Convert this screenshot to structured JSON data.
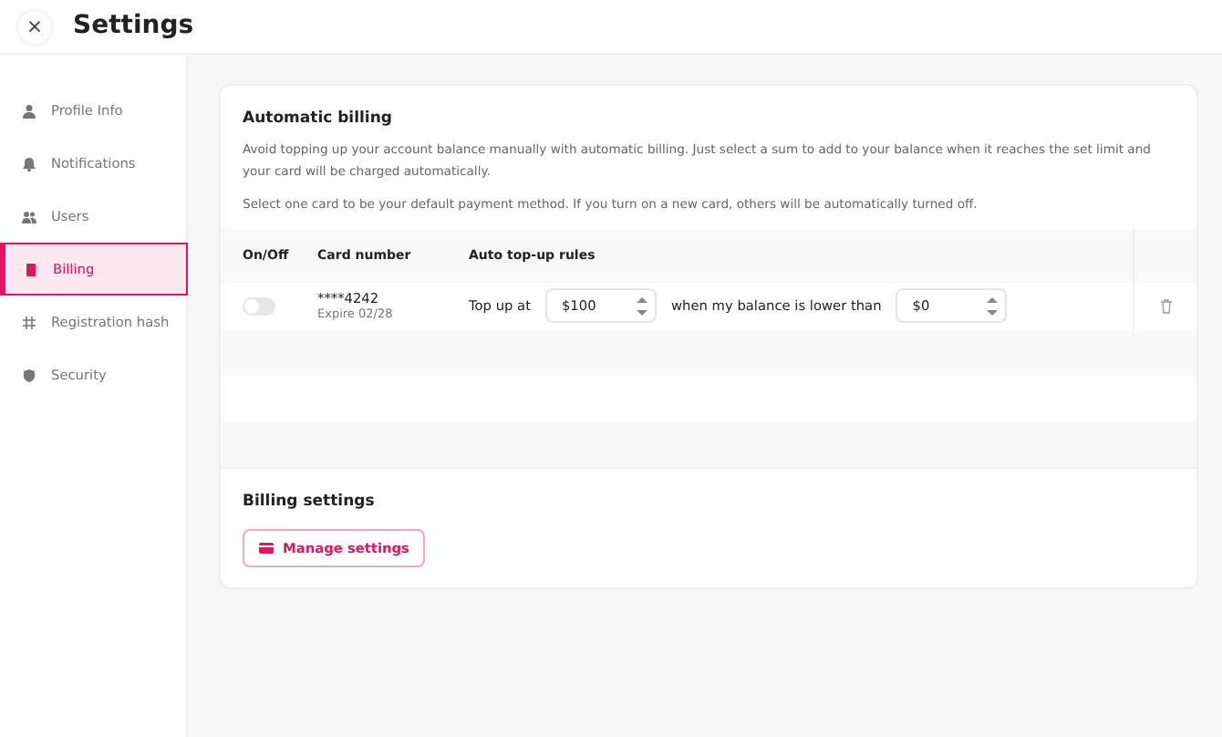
{
  "window": {
    "title": "Settings",
    "close": "×"
  },
  "sidebar": {
    "items": [
      {
        "label": "Profile Info",
        "kind": "person",
        "selected": false
      },
      {
        "label": "Notifications",
        "kind": "bell",
        "selected": false
      },
      {
        "label": "Users",
        "kind": "users",
        "selected": false
      },
      {
        "label": "Billing",
        "kind": "doc",
        "selected": true
      },
      {
        "label": "Registration hash",
        "kind": "hash",
        "selected": false
      },
      {
        "label": "Security",
        "kind": "shield",
        "selected": false
      }
    ]
  },
  "auto_billing": {
    "title": "Automatic billing",
    "description": "Avoid topping up your account balance manually with automatic billing. Just select a sum to add to your balance when it reaches the set limit and your card will be charged automatically.",
    "note": "Select one card to be your default payment method. If you turn on a new card, others will be automatically turned off.",
    "table": {
      "columns": [
        "On/Off",
        "Card number",
        "Auto top-up rules"
      ],
      "rows": [
        {
          "on": false,
          "card": "****4242",
          "expire": "Expire 02/28",
          "rule_prefix": "Top up at",
          "amount": "$100",
          "rule_middle": "when my balance is lower than",
          "limit": "$0"
        }
      ]
    }
  },
  "billing_settings": {
    "title": "Billing settings",
    "button": "Manage settings"
  }
}
